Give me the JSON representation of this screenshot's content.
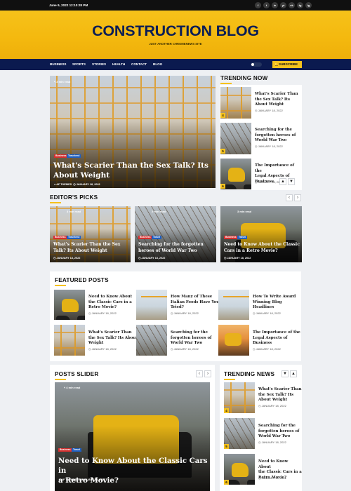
{
  "topbar": {
    "date": "June 9, 2022 12:10:28 PM",
    "social": [
      "f",
      "t",
      "in",
      "yt",
      "vk",
      "tg",
      "ig"
    ]
  },
  "header": {
    "logo": "CONSTRUCTION BLOG",
    "tagline": "JUST ANOTHER CHROMENEWS SITE"
  },
  "nav": {
    "items": [
      "BUSINESS",
      "SPORTS",
      "STORIES",
      "HEALTH",
      "CONTACT",
      "BLOG"
    ],
    "subscribe": "SUBSCRIBE"
  },
  "hero": {
    "read": "3 min read",
    "tags": [
      "Business",
      "Travelend"
    ],
    "title_lines": [
      "What's Scarier Than the Sex Talk? Its",
      "About Weight"
    ],
    "author": "AF THEMES",
    "date": "JANUARY 18, 2022"
  },
  "trending_now": {
    "title": "TRENDING NOW",
    "items": [
      {
        "num": "4",
        "lines": [
          "What's Scarier Than",
          "the Sex Talk? Its",
          "About Weight"
        ],
        "date": "JANUARY 18, 2022"
      },
      {
        "num": "5",
        "lines": [
          "Searching for the",
          "forgotten heroes of",
          "World War Two"
        ],
        "date": "JANUARY 18, 2022"
      },
      {
        "num": "6",
        "lines": [
          "The Importance of the",
          "Legal Aspects of",
          "Business"
        ],
        "date": "JANUARY 18, 2022"
      }
    ]
  },
  "editors_picks": {
    "title": "EDITOR'S PICKS",
    "items": [
      {
        "read": "3 min read",
        "tags": [
          "Business",
          "Travelend"
        ],
        "lines": [
          "What's Scarier Than the Sex",
          "Talk? Its About Weight"
        ],
        "date": "JANUARY 18, 2022"
      },
      {
        "read": "2 min read",
        "tags": [
          "Business",
          "Travel"
        ],
        "lines": [
          "Searching for the forgotten",
          "heroes of World War Two"
        ],
        "date": "JANUARY 18, 2022"
      },
      {
        "read": "3 min read",
        "tags": [
          "Business",
          "Travel"
        ],
        "lines": [
          "Need to Know About the Classic",
          "Cars in a Retro Movie?"
        ],
        "date": "JANUARY 18, 2022"
      }
    ]
  },
  "featured_posts": {
    "title": "FEATURED POSTS",
    "items": [
      {
        "lines": [
          "Need to Know About",
          "the Classic Cars in a",
          "Retro Movie?"
        ],
        "date": "JANUARY 18, 2022"
      },
      {
        "lines": [
          "How Many of These",
          "Italian Foods Have You",
          "Tried?"
        ],
        "date": "JANUARY 18, 2022"
      },
      {
        "lines": [
          "How To Write Award",
          "Winning Blog",
          "Headlines"
        ],
        "date": "JANUARY 18, 2022"
      },
      {
        "lines": [
          "What's Scarier Than",
          "the Sex Talk? Its About",
          "Weight"
        ],
        "date": "JANUARY 18, 2022"
      },
      {
        "lines": [
          "Searching for the",
          "forgotten heroes of",
          "World War Two"
        ],
        "date": "JANUARY 18, 2022"
      },
      {
        "lines": [
          "The Importance of the",
          "Legal Aspects of",
          "Business"
        ],
        "date": "JANUARY 18, 2022"
      }
    ]
  },
  "posts_slider": {
    "title": "POSTS SLIDER",
    "read": "4 min read",
    "tags": [
      "Business",
      "Travel"
    ],
    "title_lines": [
      "Need to Know About the Classic Cars in",
      "a Retro Movie?"
    ],
    "author": "AF THEMES",
    "date": "JANUARY 18, 2022"
  },
  "trending_news": {
    "title": "TRENDING NEWS",
    "items": [
      {
        "num": "4",
        "lines": [
          "What's Scarier Than",
          "the Sex Talk? Its",
          "About Weight"
        ],
        "date": "JANUARY 18, 2022"
      },
      {
        "num": "5",
        "lines": [
          "Searching for the",
          "forgotten heroes of",
          "World War Two"
        ],
        "date": "JANUARY 18, 2022"
      },
      {
        "num": "6",
        "lines": [
          "Need to Know About",
          "the Classic Cars in a",
          "Retro Movie?"
        ],
        "date": "JANUARY 18, 2022"
      }
    ]
  },
  "controls": {
    "prev": "‹",
    "next": "›",
    "up": "▲",
    "down": "▼",
    "bolt": "ϟ",
    "bell": "🔔",
    "clock": "◷"
  },
  "colors": {
    "accent": "#f5c21d",
    "nav": "#0b1a4f",
    "topbar": "#101010"
  }
}
